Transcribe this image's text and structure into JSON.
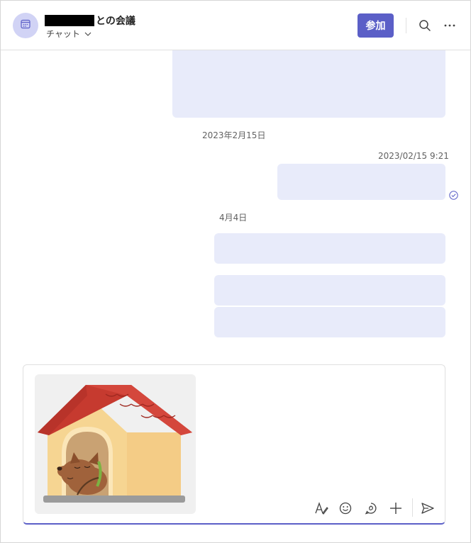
{
  "header": {
    "title_suffix": "との会議",
    "subtitle": "チャット",
    "join_label": "参加",
    "icons": {
      "avatar": "calendar-icon",
      "search": "search-icon",
      "more": "more-icon",
      "subtitle_dropdown": "chevron-down-icon"
    }
  },
  "messages": {
    "date_separators": [
      "2023年2月15日",
      "4月4日"
    ],
    "timestamp": "2023/02/15 9:21",
    "read_status_icon": "check-circle-icon"
  },
  "compose": {
    "attachment": "dog-house-sticker",
    "toolbar": {
      "format": "format-icon",
      "emoji": "emoji-icon",
      "loop": "loop-icon",
      "add": "add-icon",
      "send": "send-icon"
    },
    "accent_color": "#5b5fc7"
  },
  "colors": {
    "brand": "#5b5fc7",
    "bubble": "#e8ebfa",
    "avatar_bg": "#d1d3f5"
  }
}
